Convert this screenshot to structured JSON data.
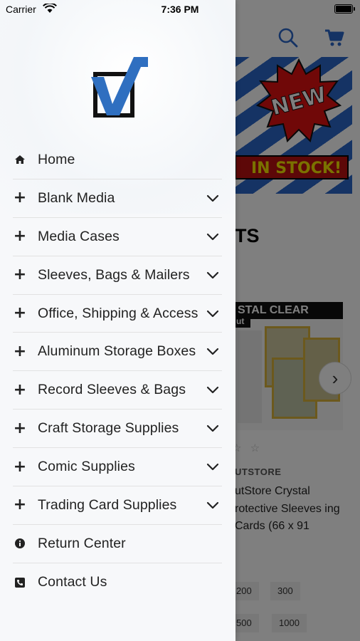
{
  "status_bar": {
    "carrier": "Carrier",
    "time": "7:36 PM"
  },
  "background": {
    "banner_new": "NEW",
    "banner_stock": "IN STOCK!",
    "section_heading": "TS",
    "product_band": "STAL CLEAR",
    "product_band_sub": "ut",
    "brand": "UTSTORE",
    "product_title": "utStore Crystal rotective Sleeves ing Cards (66 x 91",
    "chips": [
      "200",
      "300",
      "500",
      "1000"
    ],
    "next_arrow": "›",
    "stars": "☆ ☆"
  },
  "drawer": {
    "logo_icon": "checkmark-box-logo",
    "items": [
      {
        "label": "Home",
        "icon": "home-icon",
        "expandable": false
      },
      {
        "label": "Blank Media",
        "icon": "plus-icon",
        "expandable": true
      },
      {
        "label": "Media Cases",
        "icon": "plus-icon",
        "expandable": true
      },
      {
        "label": "Sleeves, Bags & Mailers",
        "icon": "plus-icon",
        "expandable": true
      },
      {
        "label": "Office, Shipping & Access",
        "icon": "plus-icon",
        "expandable": true
      },
      {
        "label": "Aluminum Storage Boxes",
        "icon": "plus-icon",
        "expandable": true
      },
      {
        "label": "Record Sleeves & Bags",
        "icon": "plus-icon",
        "expandable": true
      },
      {
        "label": "Craft Storage Supplies",
        "icon": "plus-icon",
        "expandable": true
      },
      {
        "label": "Comic Supplies",
        "icon": "plus-icon",
        "expandable": true
      },
      {
        "label": "Trading Card Supplies",
        "icon": "plus-icon",
        "expandable": true
      },
      {
        "label": "Return Center",
        "icon": "info-icon",
        "expandable": false
      },
      {
        "label": "Contact Us",
        "icon": "phone-icon",
        "expandable": false
      }
    ]
  },
  "colors": {
    "accent": "#2a66c8",
    "logo_blue": "#2f6fc0",
    "text": "#222222"
  }
}
